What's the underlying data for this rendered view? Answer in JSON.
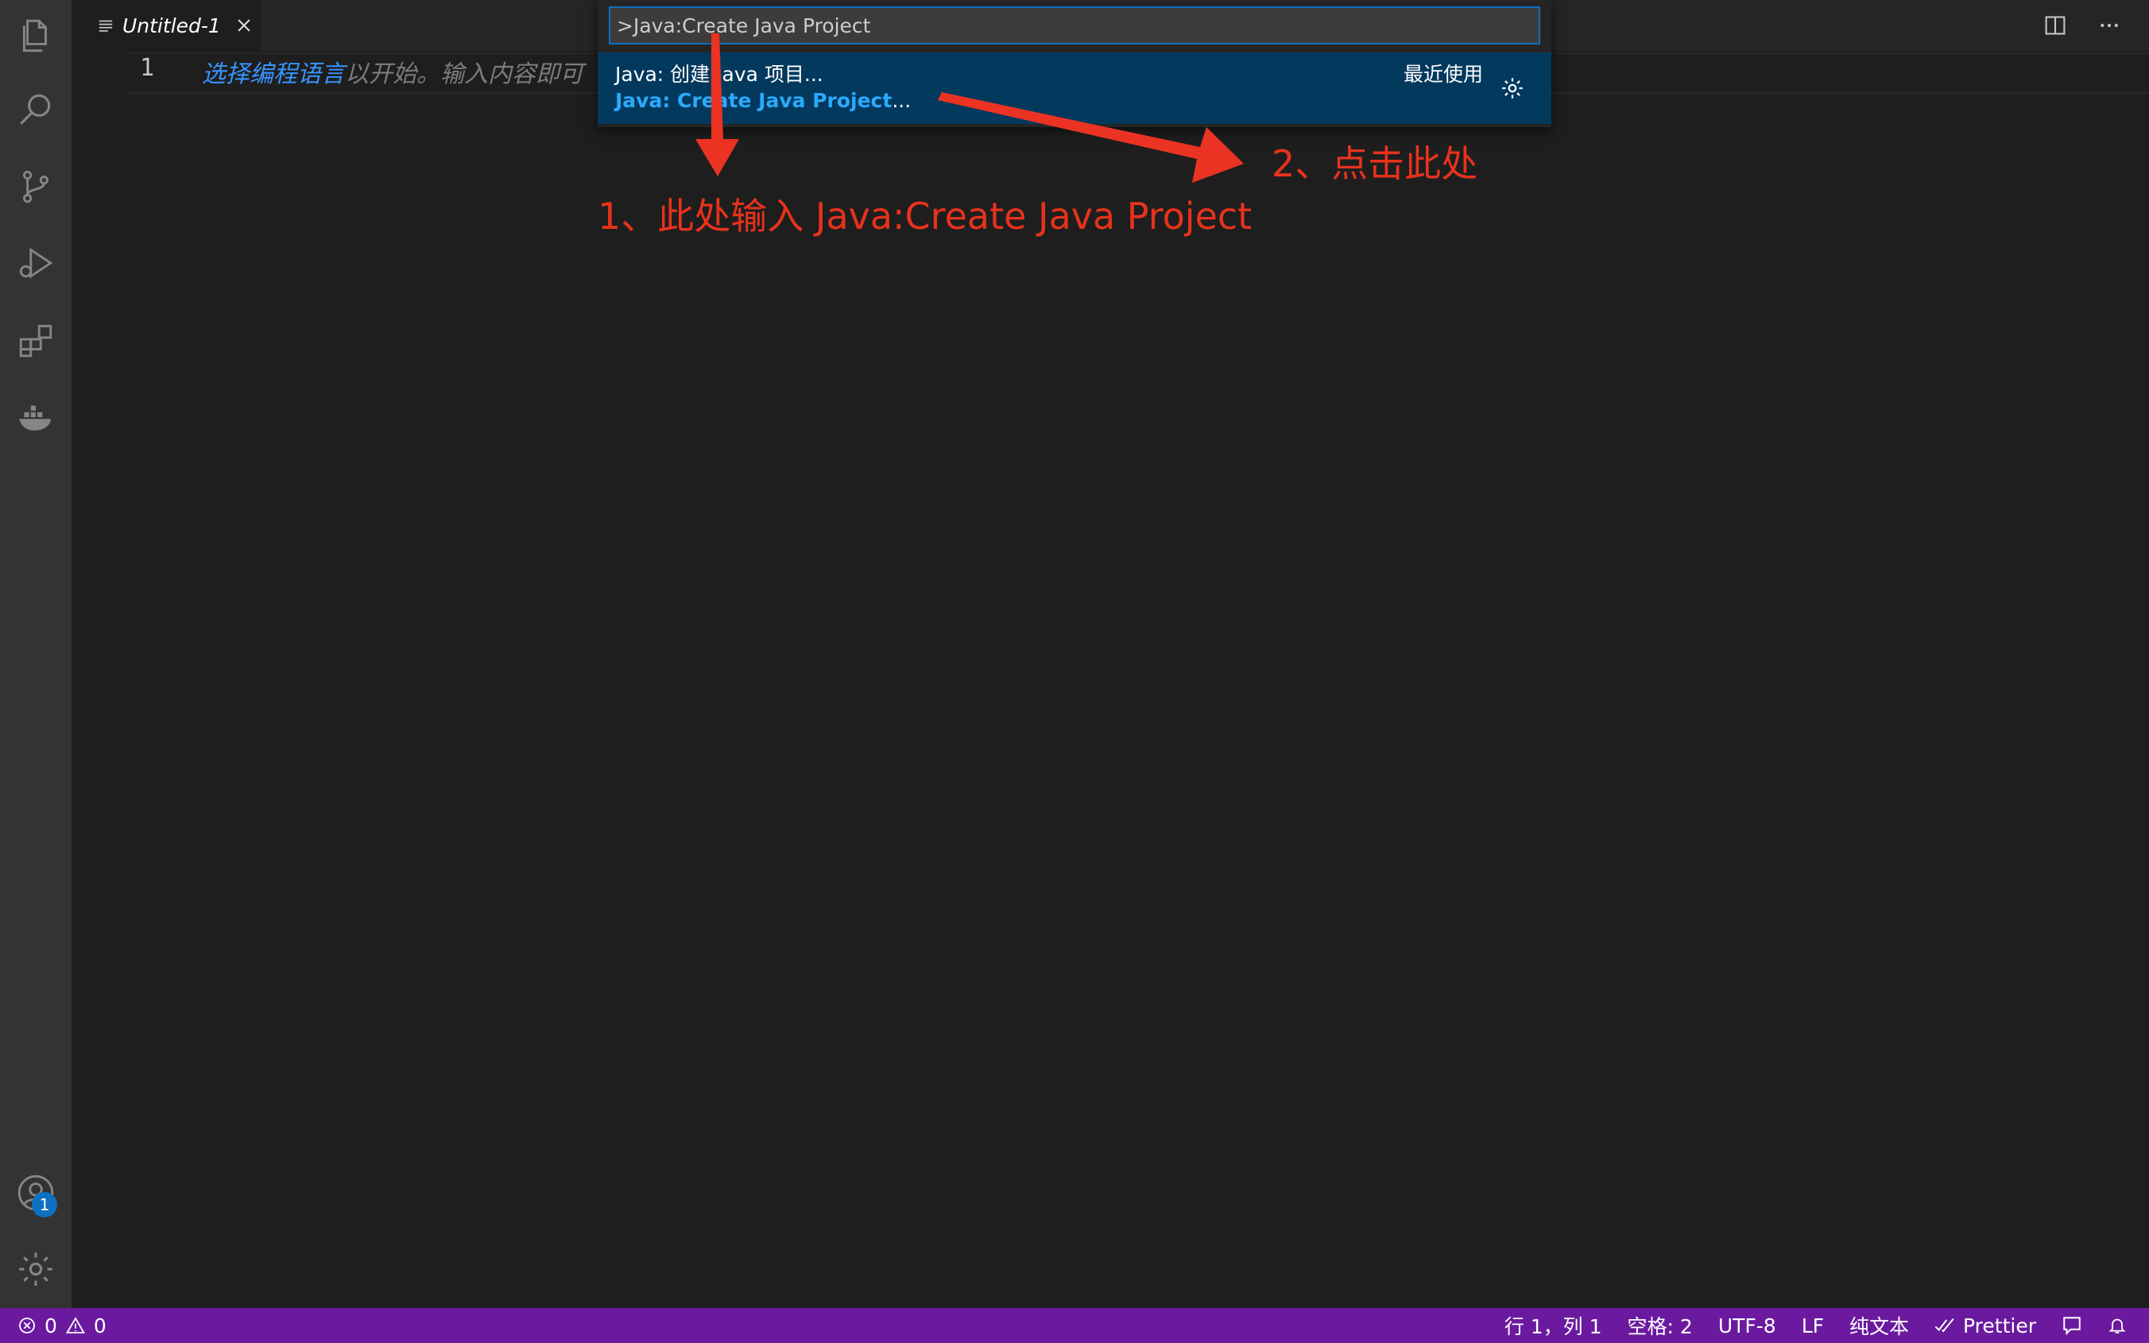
{
  "tab": {
    "title": "Untitled-1"
  },
  "editor": {
    "line_number": "1",
    "hint_link": "选择编程语言",
    "hint_rest": "以开始。输入内容即可"
  },
  "palette": {
    "input_value": ">Java:Create Java Project",
    "item_title": "Java: 创建 Java 项目...",
    "item_sub_highlight": "Java: Create Java Project",
    "item_sub_rest": "...",
    "item_recent": "最近使用"
  },
  "annotations": {
    "step1": "1、此处输入 Java:Create Java Project",
    "step2": "2、点击此处",
    "color": "#e8321c"
  },
  "activity_bar": {
    "items": [
      "files-icon",
      "search-icon",
      "source-control-icon",
      "run-debug-icon",
      "extensions-icon",
      "docker-icon"
    ],
    "account_badge": "1"
  },
  "statusbar": {
    "errors": "0",
    "warnings": "0",
    "position": "行 1，列 1",
    "spaces": "空格: 2",
    "encoding": "UTF-8",
    "eol": "LF",
    "language": "纯文本",
    "formatter": "Prettier",
    "bg_color": "#6b1a9f"
  },
  "colors": {
    "accent": "#0e70c0",
    "selection": "#04395e"
  }
}
